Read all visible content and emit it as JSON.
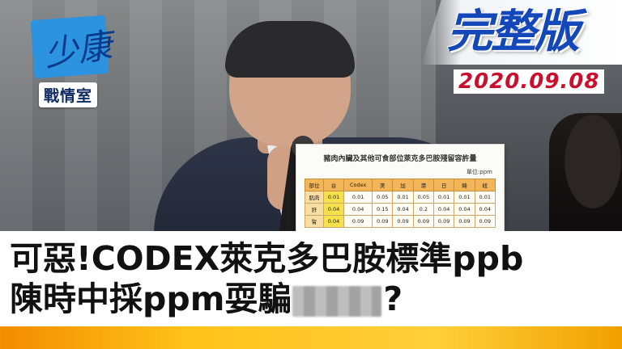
{
  "channel": {
    "logo_script": "少康",
    "label": "戰情室"
  },
  "banner": {
    "title": "完整版",
    "date": "2020.09.08"
  },
  "document": {
    "title": "豬肉內臟及其他可食部位萊克多巴胺殘留容許量",
    "unit": "單位:ppm",
    "headers": [
      "部位",
      "台",
      "Codex",
      "美",
      "加",
      "港",
      "日",
      "韓",
      "紐"
    ],
    "rows": [
      [
        "肌肉",
        "0.01",
        "0.01",
        "0.05",
        "0.01",
        "0.05",
        "0.01",
        "0.01",
        "0.01"
      ],
      [
        "肝",
        "0.04",
        "0.04",
        "0.15",
        "0.04",
        "0.2",
        "0.04",
        "0.04",
        "0.04"
      ],
      [
        "腎",
        "0.04",
        "0.09",
        "0.09",
        "0.09",
        "0.09",
        "0.09",
        "0.09",
        "0.09"
      ]
    ]
  },
  "headline": {
    "line1": "可惡!CODEX萊克多巴胺標準ppb",
    "line2_prefix": "陳時中採ppm耍騙",
    "line2_suffix": "?"
  },
  "colors": {
    "accent_blue": "#1448b8",
    "date_red": "#c8102e",
    "ticker": "#ffc21a"
  }
}
